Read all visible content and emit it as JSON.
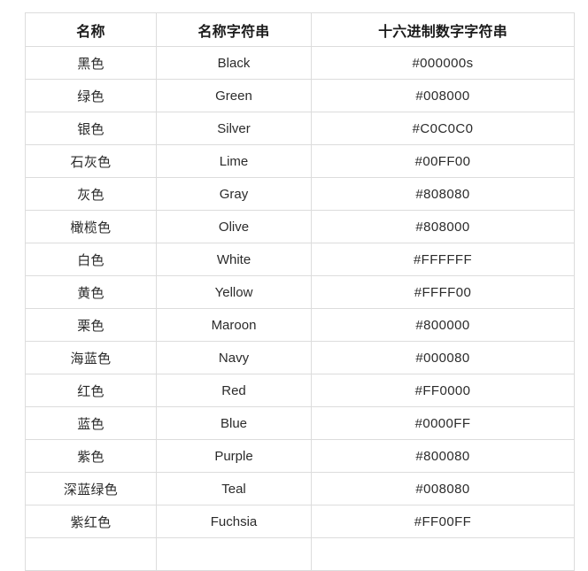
{
  "table": {
    "headers": [
      {
        "label": "名称"
      },
      {
        "label": "名称字符串"
      },
      {
        "label": "十六进制数字字符串"
      }
    ],
    "rows": [
      {
        "name_cn": "黑色",
        "name_en": "Black",
        "hex": "#000000s"
      },
      {
        "name_cn": "绿色",
        "name_en": "Green",
        "hex": "#008000"
      },
      {
        "name_cn": "银色",
        "name_en": "Silver",
        "hex": "#C0C0C0"
      },
      {
        "name_cn": "石灰色",
        "name_en": "Lime",
        "hex": "#00FF00"
      },
      {
        "name_cn": "灰色",
        "name_en": "Gray",
        "hex": "#808080"
      },
      {
        "name_cn": "橄榄色",
        "name_en": "Olive",
        "hex": "#808000"
      },
      {
        "name_cn": "白色",
        "name_en": "White",
        "hex": "#FFFFFF"
      },
      {
        "name_cn": "黄色",
        "name_en": "Yellow",
        "hex": "#FFFF00"
      },
      {
        "name_cn": "栗色",
        "name_en": "Maroon",
        "hex": "#800000"
      },
      {
        "name_cn": "海蓝色",
        "name_en": "Navy",
        "hex": "#000080"
      },
      {
        "name_cn": "红色",
        "name_en": "Red",
        "hex": "#FF0000"
      },
      {
        "name_cn": "蓝色",
        "name_en": "Blue",
        "hex": "#0000FF"
      },
      {
        "name_cn": "紫色",
        "name_en": "Purple",
        "hex": "#800080"
      },
      {
        "name_cn": "深蓝绿色",
        "name_en": "Teal",
        "hex": "#008080"
      },
      {
        "name_cn": "紫红色",
        "name_en": "Fuchsia",
        "hex": "#FF00FF"
      },
      {
        "name_cn": "",
        "name_en": "",
        "hex": ""
      }
    ]
  },
  "style": {
    "border_color": "#dcdcdc",
    "header_text_color": "#1b1b1b",
    "body_text_color": "#2b2b2b",
    "background_color": "#ffffff"
  }
}
